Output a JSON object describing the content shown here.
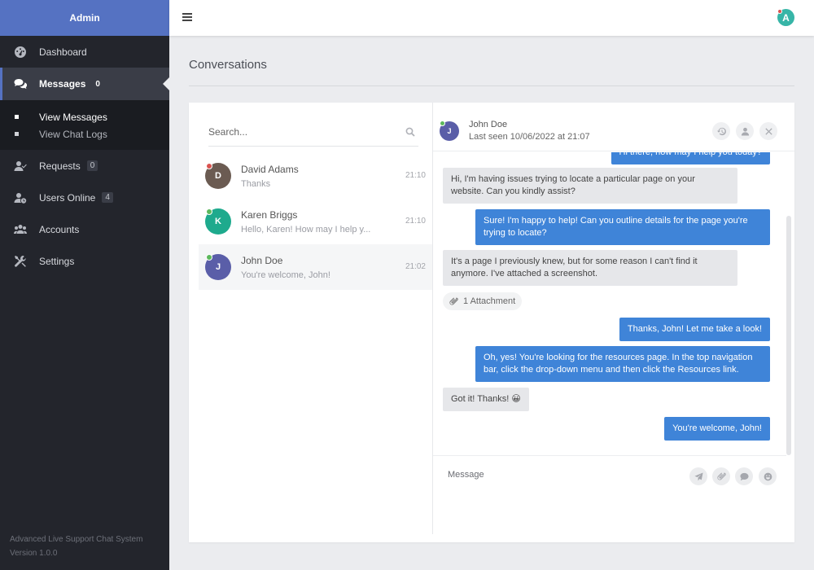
{
  "sidebar": {
    "brand": "Admin",
    "items": [
      {
        "label": "Dashboard",
        "icon": "dashboard-icon",
        "badge": ""
      },
      {
        "label": "Messages",
        "icon": "comments-icon",
        "badge": "0"
      },
      {
        "label": "Requests",
        "icon": "user-check-icon",
        "badge": "0"
      },
      {
        "label": "Users Online",
        "icon": "user-clock-icon",
        "badge": "4"
      },
      {
        "label": "Accounts",
        "icon": "users-icon",
        "badge": ""
      },
      {
        "label": "Settings",
        "icon": "tools-icon",
        "badge": ""
      }
    ],
    "subitems": [
      {
        "label": "View Messages"
      },
      {
        "label": "View Chat Logs"
      }
    ],
    "footer_app": "Advanced Live Support Chat System",
    "footer_version": "Version 1.0.0"
  },
  "topbar": {
    "avatar_initial": "A"
  },
  "page": {
    "title": "Conversations"
  },
  "search": {
    "placeholder": "Search..."
  },
  "conversations": [
    {
      "initial": "D",
      "name": "David Adams",
      "preview": "Thanks",
      "time": "21:10",
      "avatar_color": "#6b5b52",
      "status_color": "#d9534f"
    },
    {
      "initial": "K",
      "name": "Karen Briggs",
      "preview": "Hello, Karen! How may I help y...",
      "time": "21:10",
      "avatar_color": "#1eaa8d",
      "status_color": "#5cb85c"
    },
    {
      "initial": "J",
      "name": "John Doe",
      "preview": "You're welcome, John!",
      "time": "21:02",
      "avatar_color": "#5a5ea8",
      "status_color": "#5cb85c"
    }
  ],
  "chat": {
    "name": "John Doe",
    "last_seen": "Last seen 10/06/2022 at 21:07",
    "initial": "J",
    "messages": [
      {
        "dir": "out",
        "text": "Hi there, how may I help you today?"
      },
      {
        "dir": "in",
        "text": "Hi, I'm having issues trying to locate a particular page on your website. Can you kindly assist?"
      },
      {
        "dir": "out",
        "text": "Sure! I'm happy to help! Can you outline details for the page you're trying to locate?"
      },
      {
        "dir": "in",
        "text": "It's a page I previously knew, but for some reason I can't find it anymore. I've attached a screenshot."
      },
      {
        "dir": "out",
        "text": "Thanks, John! Let me take a look!"
      },
      {
        "dir": "out",
        "text": "Oh, yes! You're looking for the resources page. In the top navigation bar, click the drop-down menu and then click the Resources link."
      },
      {
        "dir": "in",
        "text": "Got it! Thanks! 😀"
      },
      {
        "dir": "out",
        "text": "You're welcome, John!"
      }
    ],
    "attachment_label": "1 Attachment",
    "composer_placeholder": "Message"
  }
}
